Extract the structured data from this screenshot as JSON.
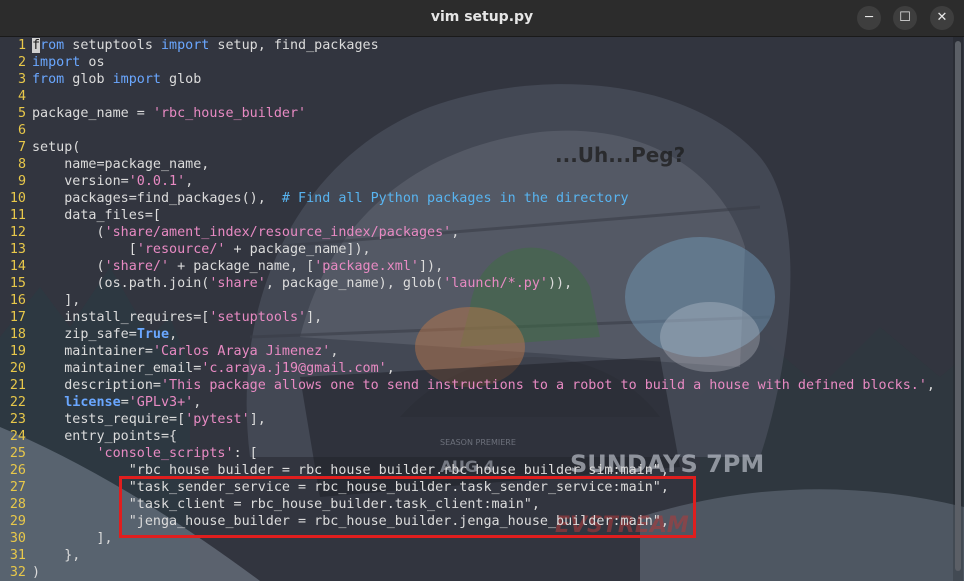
{
  "window": {
    "title": "vim setup.py",
    "minimize_label": "─",
    "maximize_label": "☐",
    "close_label": "✕"
  },
  "background_art": {
    "headline": "...Uh...Peg?",
    "schedule_day": "AUG 4",
    "schedule_text": "SUNDAYS 7PM",
    "brand": "EVSTREAM",
    "season_label": "SEASON PREMIERE"
  },
  "editor": {
    "lines": [
      {
        "num": "1",
        "segments": [
          {
            "t": "f",
            "c": "cursor"
          },
          {
            "t": "rom",
            "c": "kw"
          },
          {
            "t": " setuptools ",
            "c": "txt"
          },
          {
            "t": "import",
            "c": "kw"
          },
          {
            "t": " setup, find_packages",
            "c": "txt"
          }
        ]
      },
      {
        "num": "2",
        "segments": [
          {
            "t": "import",
            "c": "kw"
          },
          {
            "t": " os",
            "c": "txt"
          }
        ]
      },
      {
        "num": "3",
        "segments": [
          {
            "t": "from",
            "c": "kw"
          },
          {
            "t": " glob ",
            "c": "txt"
          },
          {
            "t": "import",
            "c": "kw"
          },
          {
            "t": " glob",
            "c": "txt"
          }
        ]
      },
      {
        "num": "4",
        "segments": []
      },
      {
        "num": "5",
        "segments": [
          {
            "t": "package_name = ",
            "c": "txt"
          },
          {
            "t": "'rbc_house_builder'",
            "c": "str"
          }
        ]
      },
      {
        "num": "6",
        "segments": []
      },
      {
        "num": "7",
        "segments": [
          {
            "t": "setup(",
            "c": "txt"
          }
        ]
      },
      {
        "num": "8",
        "segments": [
          {
            "t": "    name=package_name,",
            "c": "txt"
          }
        ]
      },
      {
        "num": "9",
        "segments": [
          {
            "t": "    version=",
            "c": "txt"
          },
          {
            "t": "'0.0.1'",
            "c": "str"
          },
          {
            "t": ",",
            "c": "txt"
          }
        ]
      },
      {
        "num": "10",
        "segments": [
          {
            "t": "    packages=find_packages(),  ",
            "c": "txt"
          },
          {
            "t": "# Find all Python packages in the directory",
            "c": "cm"
          }
        ]
      },
      {
        "num": "11",
        "segments": [
          {
            "t": "    data_files=[",
            "c": "txt"
          }
        ]
      },
      {
        "num": "12",
        "segments": [
          {
            "t": "        (",
            "c": "txt"
          },
          {
            "t": "'share/ament_index/resource_index/packages'",
            "c": "str"
          },
          {
            "t": ",",
            "c": "txt"
          }
        ]
      },
      {
        "num": "13",
        "segments": [
          {
            "t": "            [",
            "c": "txt"
          },
          {
            "t": "'resource/'",
            "c": "str"
          },
          {
            "t": " + package_name]),",
            "c": "txt"
          }
        ]
      },
      {
        "num": "14",
        "segments": [
          {
            "t": "        (",
            "c": "txt"
          },
          {
            "t": "'share/'",
            "c": "str"
          },
          {
            "t": " + package_name, [",
            "c": "txt"
          },
          {
            "t": "'package.xml'",
            "c": "str"
          },
          {
            "t": "]),",
            "c": "txt"
          }
        ]
      },
      {
        "num": "15",
        "segments": [
          {
            "t": "        (os.path.join(",
            "c": "txt"
          },
          {
            "t": "'share'",
            "c": "str"
          },
          {
            "t": ", package_name), glob(",
            "c": "txt"
          },
          {
            "t": "'launch/*.py'",
            "c": "str"
          },
          {
            "t": ")),",
            "c": "txt"
          }
        ]
      },
      {
        "num": "16",
        "segments": [
          {
            "t": "    ],",
            "c": "txt"
          }
        ]
      },
      {
        "num": "17",
        "segments": [
          {
            "t": "    install_requires=[",
            "c": "txt"
          },
          {
            "t": "'setuptools'",
            "c": "str"
          },
          {
            "t": "],",
            "c": "txt"
          }
        ]
      },
      {
        "num": "18",
        "segments": [
          {
            "t": "    zip_safe=",
            "c": "txt"
          },
          {
            "t": "True",
            "c": "bi"
          },
          {
            "t": ",",
            "c": "txt"
          }
        ]
      },
      {
        "num": "19",
        "segments": [
          {
            "t": "    maintainer=",
            "c": "txt"
          },
          {
            "t": "'Carlos Araya Jimenez'",
            "c": "str"
          },
          {
            "t": ",",
            "c": "txt"
          }
        ]
      },
      {
        "num": "20",
        "segments": [
          {
            "t": "    maintainer_email=",
            "c": "txt"
          },
          {
            "t": "'c.araya.j19@gmail.com'",
            "c": "str"
          },
          {
            "t": ",",
            "c": "txt"
          }
        ]
      },
      {
        "num": "21",
        "segments": [
          {
            "t": "    description=",
            "c": "txt"
          },
          {
            "t": "'This package allows one to send instructions to a robot to build a house with defined blocks.'",
            "c": "str"
          },
          {
            "t": ",",
            "c": "txt"
          }
        ]
      },
      {
        "num": "22",
        "segments": [
          {
            "t": "    ",
            "c": "txt"
          },
          {
            "t": "license",
            "c": "bi"
          },
          {
            "t": "=",
            "c": "txt"
          },
          {
            "t": "'GPLv3+'",
            "c": "str"
          },
          {
            "t": ",",
            "c": "txt"
          }
        ]
      },
      {
        "num": "23",
        "segments": [
          {
            "t": "    tests_require=[",
            "c": "txt"
          },
          {
            "t": "'pytest'",
            "c": "str"
          },
          {
            "t": "],",
            "c": "txt"
          }
        ]
      },
      {
        "num": "24",
        "segments": [
          {
            "t": "    entry_points={",
            "c": "txt"
          }
        ]
      },
      {
        "num": "25",
        "segments": [
          {
            "t": "        ",
            "c": "txt"
          },
          {
            "t": "'console_scripts'",
            "c": "str"
          },
          {
            "t": ": [",
            "c": "txt"
          }
        ]
      },
      {
        "num": "26",
        "segments": [
          {
            "t": "            \"rbc_house_builder = rbc_house_builder.rbc_house_builder_sim:main\",",
            "c": "txt"
          }
        ]
      },
      {
        "num": "27",
        "segments": [
          {
            "t": "            \"task_sender_service = rbc_house_builder.task_sender_service:main\",",
            "c": "txt"
          }
        ]
      },
      {
        "num": "28",
        "segments": [
          {
            "t": "            \"task_client = rbc_house_builder.task_client:main\",",
            "c": "txt"
          }
        ]
      },
      {
        "num": "29",
        "segments": [
          {
            "t": "            \"jenga_house_builder = rbc_house_builder.jenga_house_builder:main\",",
            "c": "txt"
          }
        ]
      },
      {
        "num": "30",
        "segments": [
          {
            "t": "        ],",
            "c": "txt"
          }
        ]
      },
      {
        "num": "31",
        "segments": [
          {
            "t": "    },",
            "c": "txt"
          }
        ]
      },
      {
        "num": "32",
        "segments": [
          {
            "t": ")",
            "c": "txt"
          }
        ]
      }
    ]
  },
  "colors": {
    "line_number": "#e8c84a",
    "keyword": "#6aa7ff",
    "string": "#e88ac3",
    "comment": "#58b4f0",
    "highlight_box": "#e01e1e"
  }
}
